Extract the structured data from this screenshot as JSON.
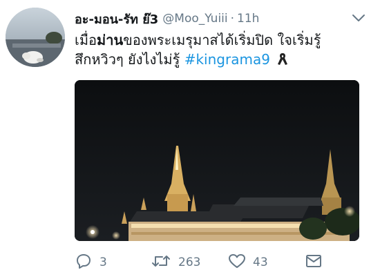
{
  "tweet": {
    "display_name": "อะ-มอน-รัท ย๊3",
    "handle": "@Moo_Yuiii",
    "separator": "·",
    "time": "11h",
    "text_line1_start": "เมื่อ",
    "text_bold": "ม่าน",
    "text_line1_rest": "ของพระเมรุมาสได้เริ่มปิด ใจเริ่มรู้",
    "text_line2": "สึกหวิวๆ ยังไงไม่รู้",
    "hashtag": "#kingrama9",
    "emoji_name": "black-ribbon-icon"
  },
  "actions": {
    "reply_count": "3",
    "retweet_count": "263",
    "like_count": "43"
  },
  "icons": {
    "menu": "chevron-down-icon",
    "reply": "reply-icon",
    "retweet": "retweet-icon",
    "like": "heart-icon",
    "dm": "envelope-icon"
  },
  "colors": {
    "hashtag": "#1b95e0",
    "secondary_text": "#657786",
    "primary_text": "#14171a"
  }
}
